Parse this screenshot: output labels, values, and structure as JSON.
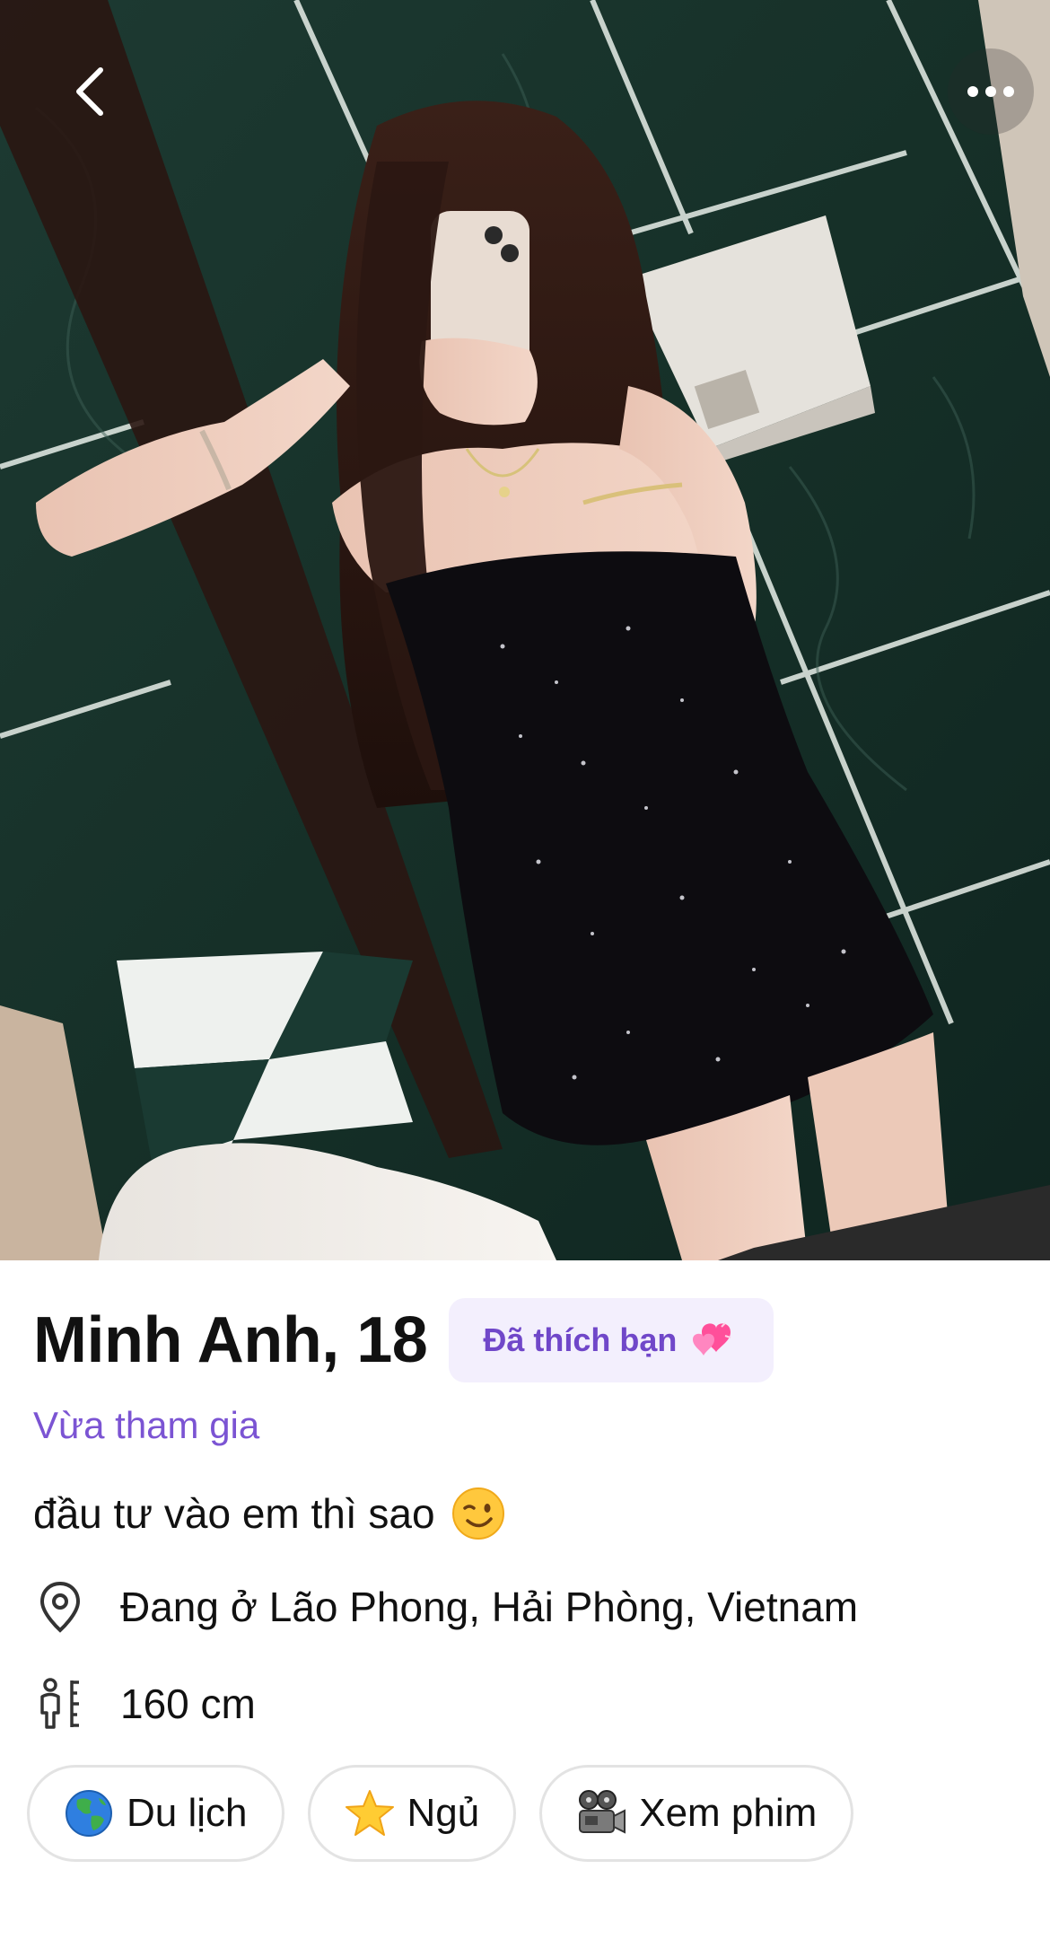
{
  "profile": {
    "name_age": "Minh Anh, 18",
    "liked_badge": "Đã thích bạn",
    "liked_badge_icon": "pink-hearts-emoji",
    "joined_status": "Vừa tham gia",
    "bio": "đầu tư vào em thì sao",
    "bio_icon": "winking-face-emoji",
    "location": "Đang ở Lão Phong, Hải Phòng, Vietnam",
    "location_icon": "location-pin-icon",
    "height": "160 cm",
    "height_icon": "height-ruler-icon"
  },
  "interests": [
    {
      "label": "Du lịch",
      "icon": "globe-emoji"
    },
    {
      "label": "Ngủ",
      "icon": "star-emoji"
    },
    {
      "label": "Xem phim",
      "icon": "film-projector-emoji"
    }
  ],
  "nav": {
    "back_icon": "chevron-left-icon",
    "more_icon": "more-dots-icon"
  },
  "colors": {
    "accent_purple": "#7047c9",
    "badge_bg": "#f3effd",
    "text_primary": "#111111",
    "chip_border": "#e3e3e3"
  }
}
